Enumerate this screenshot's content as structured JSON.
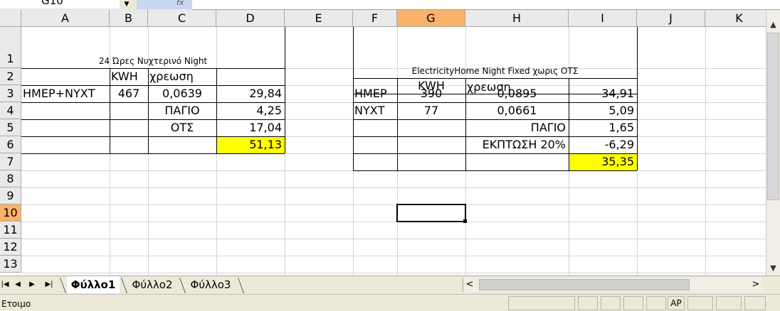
{
  "formula_bar": {
    "name_box": "G10",
    "fx_symbol": "fx"
  },
  "columns": [
    "A",
    "B",
    "C",
    "D",
    "E",
    "F",
    "G",
    "H",
    "I",
    "J",
    "K"
  ],
  "rows": [
    "1",
    "2",
    "3",
    "4",
    "5",
    "6",
    "7",
    "8",
    "9",
    "10",
    "11",
    "12",
    "13"
  ],
  "selected_column": "G",
  "selected_row": "10",
  "table1": {
    "title": "24 Ώρες Νυχτερινό Night",
    "header_kwh": "KWH",
    "header_charge": "χρεωση",
    "r3": {
      "a": "ΗΜΕΡ+ΝΥΧΤ",
      "b": "467",
      "c": "0,0639",
      "d": "29,84"
    },
    "r4": {
      "c": "ΠΑΓΙΟ",
      "d": "4,25"
    },
    "r5": {
      "c": "ΟΤΣ",
      "d": "17,04"
    },
    "r6": {
      "d": "51,13"
    }
  },
  "table2": {
    "title": "ElectricityHome Night Fixed χωρις ΟΤΣ",
    "header_kwh": "KWH",
    "header_charge": "χρεωση",
    "r3": {
      "f": "ΗΜΕΡ",
      "g": "390",
      "h": "0,0895",
      "i": "34,91"
    },
    "r4": {
      "f": "ΝΥΧΤ",
      "g": "77",
      "h": "0,0661",
      "i": "5,09"
    },
    "r5": {
      "h": "ΠΑΓΙΟ",
      "i": "1,65"
    },
    "r6": {
      "h": "ΕΚΠΤΩΣΗ 20%",
      "i": "-6,29"
    },
    "r7": {
      "i": "35,35"
    }
  },
  "highlight_color": "#ffff00",
  "selection_header_color": "#f8b26a",
  "sheets": [
    "Φύλλο1",
    "Φύλλο2",
    "Φύλλο3"
  ],
  "active_sheet": "Φύλλο1",
  "status": {
    "text": "Ετοιμο",
    "indicator": "ΑΡ"
  },
  "icons": {
    "nav": [
      "first-sheet-icon",
      "prev-sheet-icon",
      "next-sheet-icon",
      "last-sheet-icon"
    ],
    "scroll": [
      "scroll-up-icon",
      "scroll-down-icon",
      "scroll-left-icon",
      "scroll-right-icon"
    ]
  }
}
